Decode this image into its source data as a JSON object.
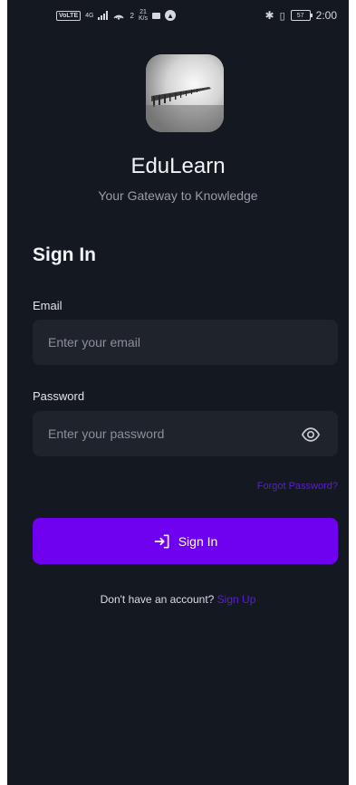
{
  "status_bar": {
    "network_chip": "VoLTE",
    "signal_type": "4G",
    "hotspot_count": "2",
    "speed_value": "21",
    "speed_unit": "K/s",
    "battery": "57",
    "time": "2:00"
  },
  "app": {
    "name": "EduLearn",
    "tagline": "Your Gateway to Knowledge"
  },
  "form": {
    "heading": "Sign In",
    "email_label": "Email",
    "email_placeholder": "Enter your email",
    "password_label": "Password",
    "password_placeholder": "Enter your password",
    "forgot_password": "Forgot Password?",
    "submit_label": "Sign In",
    "signup_prompt": "Don't have an account?",
    "signup_link": "Sign Up"
  },
  "colors": {
    "background": "#141820",
    "input_bg": "#1f232c",
    "primary": "#7000f0",
    "link": "#5a1fd1"
  }
}
